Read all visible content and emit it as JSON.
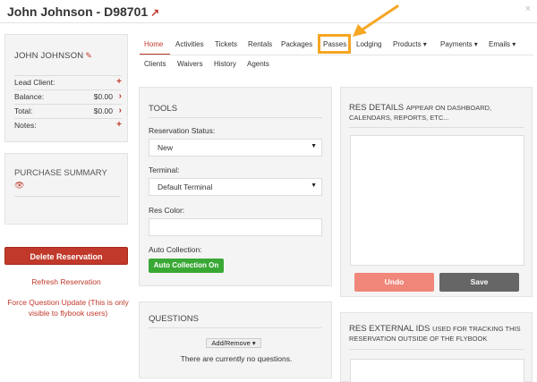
{
  "header": {
    "title": "John Johnson - D98701",
    "close": "×"
  },
  "client": {
    "name": "JOHN JOHNSON",
    "rows": [
      {
        "label": "Lead Client:",
        "value": "",
        "icon": "plus"
      },
      {
        "label": "Balance:",
        "value": "$0.00",
        "icon": "chevron-right"
      },
      {
        "label": "Total:",
        "value": "$0.00",
        "icon": "chevron-right"
      },
      {
        "label": "Notes:",
        "value": "",
        "icon": "plus"
      }
    ]
  },
  "purchase": {
    "label": "PURCHASE SUMMARY"
  },
  "actions": {
    "delete": "Delete Reservation",
    "refresh": "Refresh Reservation",
    "force": "Force Question Update (This is only visible to flybook users)"
  },
  "tabs": {
    "row1": [
      "Home",
      "Activities",
      "Tickets",
      "Rentals",
      "Packages",
      "Passes",
      "Lodging",
      "Products ▾",
      "Payments ▾",
      "Emails ▾"
    ],
    "row2": [
      "Clients",
      "Waivers",
      "History",
      "Agents"
    ],
    "active": "Home",
    "highlighted": "Passes"
  },
  "tools": {
    "title": "TOOLS",
    "status_label": "Reservation Status:",
    "status_value": "New",
    "terminal_label": "Terminal:",
    "terminal_value": "Default Terminal",
    "color_label": "Res Color:",
    "auto_label": "Auto Collection:",
    "auto_button": "Auto Collection On"
  },
  "questions": {
    "title": "QUESTIONS",
    "add_remove": "Add/Remove ▾",
    "empty": "There are currently no questions."
  },
  "res_details": {
    "title": "RES DETAILS",
    "subtitle": "APPEAR ON DASHBOARD, CALENDARS, REPORTS, ETC...",
    "undo": "Undo",
    "save": "Save"
  },
  "res_external": {
    "title": "RES EXTERNAL IDS",
    "subtitle": "USED FOR TRACKING THIS RESERVATION OUTSIDE OF THE FLYBOOK"
  },
  "colors": {
    "accent": "#c0392b",
    "highlight": "#f5a623",
    "green": "#3aa835"
  }
}
